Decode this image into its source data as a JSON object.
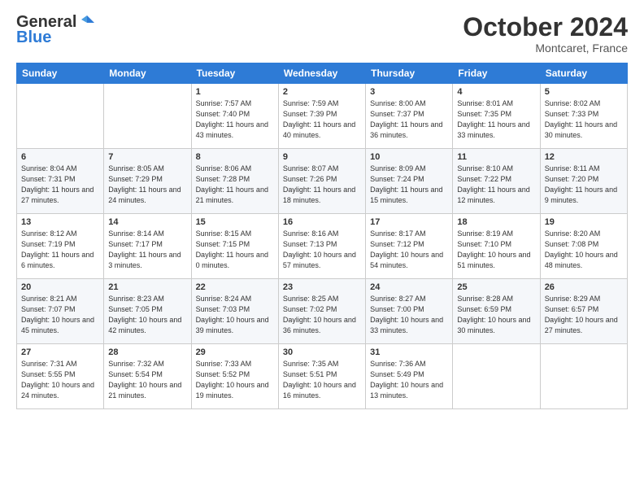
{
  "logo": {
    "general": "General",
    "blue": "Blue"
  },
  "title": "October 2024",
  "location": "Montcaret, France",
  "days_of_week": [
    "Sunday",
    "Monday",
    "Tuesday",
    "Wednesday",
    "Thursday",
    "Friday",
    "Saturday"
  ],
  "weeks": [
    {
      "days": [
        {
          "num": "",
          "info": ""
        },
        {
          "num": "",
          "info": ""
        },
        {
          "num": "1",
          "info": "Sunrise: 7:57 AM\nSunset: 7:40 PM\nDaylight: 11 hours and 43 minutes."
        },
        {
          "num": "2",
          "info": "Sunrise: 7:59 AM\nSunset: 7:39 PM\nDaylight: 11 hours and 40 minutes."
        },
        {
          "num": "3",
          "info": "Sunrise: 8:00 AM\nSunset: 7:37 PM\nDaylight: 11 hours and 36 minutes."
        },
        {
          "num": "4",
          "info": "Sunrise: 8:01 AM\nSunset: 7:35 PM\nDaylight: 11 hours and 33 minutes."
        },
        {
          "num": "5",
          "info": "Sunrise: 8:02 AM\nSunset: 7:33 PM\nDaylight: 11 hours and 30 minutes."
        }
      ]
    },
    {
      "days": [
        {
          "num": "6",
          "info": "Sunrise: 8:04 AM\nSunset: 7:31 PM\nDaylight: 11 hours and 27 minutes."
        },
        {
          "num": "7",
          "info": "Sunrise: 8:05 AM\nSunset: 7:29 PM\nDaylight: 11 hours and 24 minutes."
        },
        {
          "num": "8",
          "info": "Sunrise: 8:06 AM\nSunset: 7:28 PM\nDaylight: 11 hours and 21 minutes."
        },
        {
          "num": "9",
          "info": "Sunrise: 8:07 AM\nSunset: 7:26 PM\nDaylight: 11 hours and 18 minutes."
        },
        {
          "num": "10",
          "info": "Sunrise: 8:09 AM\nSunset: 7:24 PM\nDaylight: 11 hours and 15 minutes."
        },
        {
          "num": "11",
          "info": "Sunrise: 8:10 AM\nSunset: 7:22 PM\nDaylight: 11 hours and 12 minutes."
        },
        {
          "num": "12",
          "info": "Sunrise: 8:11 AM\nSunset: 7:20 PM\nDaylight: 11 hours and 9 minutes."
        }
      ]
    },
    {
      "days": [
        {
          "num": "13",
          "info": "Sunrise: 8:12 AM\nSunset: 7:19 PM\nDaylight: 11 hours and 6 minutes."
        },
        {
          "num": "14",
          "info": "Sunrise: 8:14 AM\nSunset: 7:17 PM\nDaylight: 11 hours and 3 minutes."
        },
        {
          "num": "15",
          "info": "Sunrise: 8:15 AM\nSunset: 7:15 PM\nDaylight: 11 hours and 0 minutes."
        },
        {
          "num": "16",
          "info": "Sunrise: 8:16 AM\nSunset: 7:13 PM\nDaylight: 10 hours and 57 minutes."
        },
        {
          "num": "17",
          "info": "Sunrise: 8:17 AM\nSunset: 7:12 PM\nDaylight: 10 hours and 54 minutes."
        },
        {
          "num": "18",
          "info": "Sunrise: 8:19 AM\nSunset: 7:10 PM\nDaylight: 10 hours and 51 minutes."
        },
        {
          "num": "19",
          "info": "Sunrise: 8:20 AM\nSunset: 7:08 PM\nDaylight: 10 hours and 48 minutes."
        }
      ]
    },
    {
      "days": [
        {
          "num": "20",
          "info": "Sunrise: 8:21 AM\nSunset: 7:07 PM\nDaylight: 10 hours and 45 minutes."
        },
        {
          "num": "21",
          "info": "Sunrise: 8:23 AM\nSunset: 7:05 PM\nDaylight: 10 hours and 42 minutes."
        },
        {
          "num": "22",
          "info": "Sunrise: 8:24 AM\nSunset: 7:03 PM\nDaylight: 10 hours and 39 minutes."
        },
        {
          "num": "23",
          "info": "Sunrise: 8:25 AM\nSunset: 7:02 PM\nDaylight: 10 hours and 36 minutes."
        },
        {
          "num": "24",
          "info": "Sunrise: 8:27 AM\nSunset: 7:00 PM\nDaylight: 10 hours and 33 minutes."
        },
        {
          "num": "25",
          "info": "Sunrise: 8:28 AM\nSunset: 6:59 PM\nDaylight: 10 hours and 30 minutes."
        },
        {
          "num": "26",
          "info": "Sunrise: 8:29 AM\nSunset: 6:57 PM\nDaylight: 10 hours and 27 minutes."
        }
      ]
    },
    {
      "days": [
        {
          "num": "27",
          "info": "Sunrise: 7:31 AM\nSunset: 5:55 PM\nDaylight: 10 hours and 24 minutes."
        },
        {
          "num": "28",
          "info": "Sunrise: 7:32 AM\nSunset: 5:54 PM\nDaylight: 10 hours and 21 minutes."
        },
        {
          "num": "29",
          "info": "Sunrise: 7:33 AM\nSunset: 5:52 PM\nDaylight: 10 hours and 19 minutes."
        },
        {
          "num": "30",
          "info": "Sunrise: 7:35 AM\nSunset: 5:51 PM\nDaylight: 10 hours and 16 minutes."
        },
        {
          "num": "31",
          "info": "Sunrise: 7:36 AM\nSunset: 5:49 PM\nDaylight: 10 hours and 13 minutes."
        },
        {
          "num": "",
          "info": ""
        },
        {
          "num": "",
          "info": ""
        }
      ]
    }
  ]
}
